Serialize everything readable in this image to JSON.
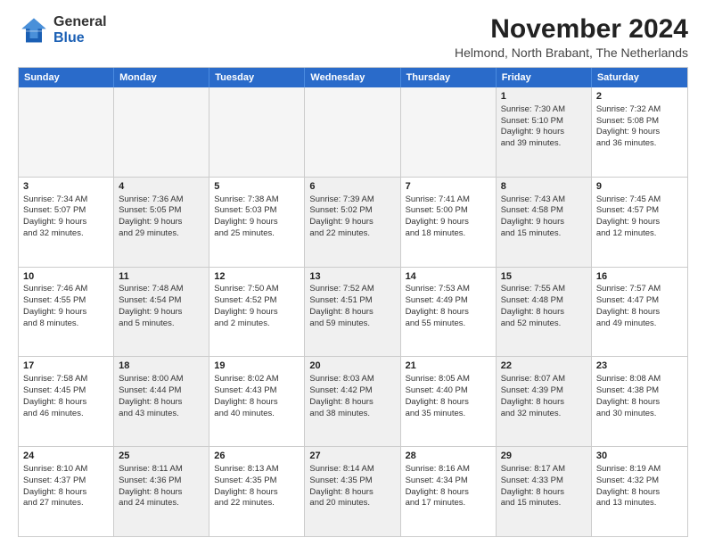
{
  "logo": {
    "line1": "General",
    "line2": "Blue"
  },
  "title": "November 2024",
  "subtitle": "Helmond, North Brabant, The Netherlands",
  "header": {
    "days": [
      "Sunday",
      "Monday",
      "Tuesday",
      "Wednesday",
      "Thursday",
      "Friday",
      "Saturday"
    ]
  },
  "weeks": [
    [
      {
        "day": "",
        "content": "",
        "empty": true
      },
      {
        "day": "",
        "content": "",
        "empty": true
      },
      {
        "day": "",
        "content": "",
        "empty": true
      },
      {
        "day": "",
        "content": "",
        "empty": true
      },
      {
        "day": "",
        "content": "",
        "empty": true
      },
      {
        "day": "1",
        "content": "Sunrise: 7:30 AM\nSunset: 5:10 PM\nDaylight: 9 hours\nand 39 minutes.",
        "shaded": true
      },
      {
        "day": "2",
        "content": "Sunrise: 7:32 AM\nSunset: 5:08 PM\nDaylight: 9 hours\nand 36 minutes.",
        "shaded": false
      }
    ],
    [
      {
        "day": "3",
        "content": "Sunrise: 7:34 AM\nSunset: 5:07 PM\nDaylight: 9 hours\nand 32 minutes.",
        "shaded": false
      },
      {
        "day": "4",
        "content": "Sunrise: 7:36 AM\nSunset: 5:05 PM\nDaylight: 9 hours\nand 29 minutes.",
        "shaded": true
      },
      {
        "day": "5",
        "content": "Sunrise: 7:38 AM\nSunset: 5:03 PM\nDaylight: 9 hours\nand 25 minutes.",
        "shaded": false
      },
      {
        "day": "6",
        "content": "Sunrise: 7:39 AM\nSunset: 5:02 PM\nDaylight: 9 hours\nand 22 minutes.",
        "shaded": true
      },
      {
        "day": "7",
        "content": "Sunrise: 7:41 AM\nSunset: 5:00 PM\nDaylight: 9 hours\nand 18 minutes.",
        "shaded": false
      },
      {
        "day": "8",
        "content": "Sunrise: 7:43 AM\nSunset: 4:58 PM\nDaylight: 9 hours\nand 15 minutes.",
        "shaded": true
      },
      {
        "day": "9",
        "content": "Sunrise: 7:45 AM\nSunset: 4:57 PM\nDaylight: 9 hours\nand 12 minutes.",
        "shaded": false
      }
    ],
    [
      {
        "day": "10",
        "content": "Sunrise: 7:46 AM\nSunset: 4:55 PM\nDaylight: 9 hours\nand 8 minutes.",
        "shaded": false
      },
      {
        "day": "11",
        "content": "Sunrise: 7:48 AM\nSunset: 4:54 PM\nDaylight: 9 hours\nand 5 minutes.",
        "shaded": true
      },
      {
        "day": "12",
        "content": "Sunrise: 7:50 AM\nSunset: 4:52 PM\nDaylight: 9 hours\nand 2 minutes.",
        "shaded": false
      },
      {
        "day": "13",
        "content": "Sunrise: 7:52 AM\nSunset: 4:51 PM\nDaylight: 8 hours\nand 59 minutes.",
        "shaded": true
      },
      {
        "day": "14",
        "content": "Sunrise: 7:53 AM\nSunset: 4:49 PM\nDaylight: 8 hours\nand 55 minutes.",
        "shaded": false
      },
      {
        "day": "15",
        "content": "Sunrise: 7:55 AM\nSunset: 4:48 PM\nDaylight: 8 hours\nand 52 minutes.",
        "shaded": true
      },
      {
        "day": "16",
        "content": "Sunrise: 7:57 AM\nSunset: 4:47 PM\nDaylight: 8 hours\nand 49 minutes.",
        "shaded": false
      }
    ],
    [
      {
        "day": "17",
        "content": "Sunrise: 7:58 AM\nSunset: 4:45 PM\nDaylight: 8 hours\nand 46 minutes.",
        "shaded": false
      },
      {
        "day": "18",
        "content": "Sunrise: 8:00 AM\nSunset: 4:44 PM\nDaylight: 8 hours\nand 43 minutes.",
        "shaded": true
      },
      {
        "day": "19",
        "content": "Sunrise: 8:02 AM\nSunset: 4:43 PM\nDaylight: 8 hours\nand 40 minutes.",
        "shaded": false
      },
      {
        "day": "20",
        "content": "Sunrise: 8:03 AM\nSunset: 4:42 PM\nDaylight: 8 hours\nand 38 minutes.",
        "shaded": true
      },
      {
        "day": "21",
        "content": "Sunrise: 8:05 AM\nSunset: 4:40 PM\nDaylight: 8 hours\nand 35 minutes.",
        "shaded": false
      },
      {
        "day": "22",
        "content": "Sunrise: 8:07 AM\nSunset: 4:39 PM\nDaylight: 8 hours\nand 32 minutes.",
        "shaded": true
      },
      {
        "day": "23",
        "content": "Sunrise: 8:08 AM\nSunset: 4:38 PM\nDaylight: 8 hours\nand 30 minutes.",
        "shaded": false
      }
    ],
    [
      {
        "day": "24",
        "content": "Sunrise: 8:10 AM\nSunset: 4:37 PM\nDaylight: 8 hours\nand 27 minutes.",
        "shaded": false
      },
      {
        "day": "25",
        "content": "Sunrise: 8:11 AM\nSunset: 4:36 PM\nDaylight: 8 hours\nand 24 minutes.",
        "shaded": true
      },
      {
        "day": "26",
        "content": "Sunrise: 8:13 AM\nSunset: 4:35 PM\nDaylight: 8 hours\nand 22 minutes.",
        "shaded": false
      },
      {
        "day": "27",
        "content": "Sunrise: 8:14 AM\nSunset: 4:35 PM\nDaylight: 8 hours\nand 20 minutes.",
        "shaded": true
      },
      {
        "day": "28",
        "content": "Sunrise: 8:16 AM\nSunset: 4:34 PM\nDaylight: 8 hours\nand 17 minutes.",
        "shaded": false
      },
      {
        "day": "29",
        "content": "Sunrise: 8:17 AM\nSunset: 4:33 PM\nDaylight: 8 hours\nand 15 minutes.",
        "shaded": true
      },
      {
        "day": "30",
        "content": "Sunrise: 8:19 AM\nSunset: 4:32 PM\nDaylight: 8 hours\nand 13 minutes.",
        "shaded": false
      }
    ]
  ]
}
